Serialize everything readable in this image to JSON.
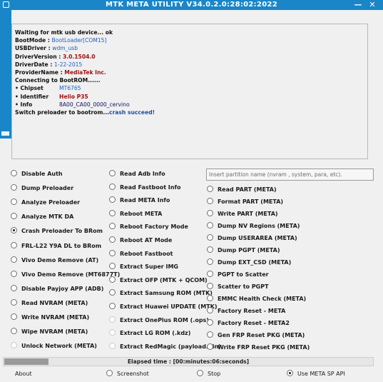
{
  "window": {
    "title": "MTK META UTILITY V34.0.2.0:28:02:2022",
    "minimize_label": "—",
    "close_label": "✕"
  },
  "log": {
    "lines": [
      {
        "text": "Waiting for mtk usb device... ok",
        "value": ""
      },
      {
        "text": "BootMode : ",
        "value": "BootLoader[COM15]",
        "style": "blue"
      },
      {
        "text": "USBDriver : ",
        "value": "wdm_usb",
        "style": "blue"
      },
      {
        "text": "DriverVersion : ",
        "value": "3.0.1504.0",
        "style": "red"
      },
      {
        "text": "DriverDate : ",
        "value": "1-22-2015",
        "style": "blue"
      },
      {
        "text": "ProviderName : ",
        "value": "MediaTek Inc.",
        "style": "red"
      },
      {
        "text": "Connecting to BootROM......",
        "value": ""
      },
      {
        "text": "• Chipset",
        "value": "MT6765",
        "style": "blue"
      },
      {
        "text": "• Identifier",
        "value": "Helio P35",
        "style": "red"
      },
      {
        "text": "• Info",
        "value": "8A00_CA00_0000_cervino",
        "style": "navy"
      },
      {
        "text": "Switch preloader to bootrom...",
        "value": "crash succeed!",
        "style": "green"
      }
    ]
  },
  "col1": [
    {
      "label": "Disable Auth"
    },
    {
      "label": "Dump Preloader"
    },
    {
      "label": "Analyze Preloader"
    },
    {
      "label": "Analyze MTK DA"
    },
    {
      "label": "Crash Preloader To BRom",
      "checked": true
    },
    {
      "label": "FRL-L22 Y9A DL to BRom"
    },
    {
      "label": "Vivo Demo Remove (AT)"
    },
    {
      "label": "Vivo Demo Remove (MT6877T)"
    },
    {
      "label": "Disable Payjoy APP (ADB)"
    },
    {
      "label": "Read NVRAM (META)"
    },
    {
      "label": "Write NVRAM (META)"
    },
    {
      "label": "Wipe NVRAM (META)"
    },
    {
      "label": "Unlock Network (META)",
      "disabled": true
    }
  ],
  "col2": [
    {
      "label": "Read Adb Info"
    },
    {
      "label": "Read Fastboot Info"
    },
    {
      "label": "Read META Info"
    },
    {
      "label": "Reboot META"
    },
    {
      "label": "Reboot Factory Mode"
    },
    {
      "label": "Reboot AT Mode"
    },
    {
      "label": "Reboot Fastboot"
    },
    {
      "label": "Extract Super IMG"
    },
    {
      "label": "Extract OFP (MTK + QCOM)"
    },
    {
      "label": "Extract Samsung ROM (MTK)"
    },
    {
      "label": "Extract Huawei UPDATE (MTK)"
    },
    {
      "label": "Extract OnePlus ROM (.ops)",
      "disabled": true
    },
    {
      "label": "Extract LG ROM (.kdz)",
      "disabled": true
    },
    {
      "label": "Extract RedMagic (payload.bin)",
      "disabled": true
    }
  ],
  "partition": {
    "placeholder": "Insert partition name (nvram , system, para, etc)."
  },
  "col3": [
    {
      "label": "Read PART (META)"
    },
    {
      "label": "Format PART (META)"
    },
    {
      "label": "Write PART (META)"
    },
    {
      "label": "Dump NV Regions (META)"
    },
    {
      "label": "Dump USERAREA (META)"
    },
    {
      "label": "Dump PGPT (META)"
    },
    {
      "label": "Dump  EXT_CSD (META)"
    },
    {
      "label": "PGPT to Scatter"
    },
    {
      "label": "Scatter to PGPT"
    },
    {
      "label": "EMMC Health Check (META)"
    },
    {
      "label": "Factory Reset - META"
    },
    {
      "label": "Factory Reset - META2"
    },
    {
      "label": "Gen FRP Reset PKG (META)"
    },
    {
      "label": "Write FRP Reset PKG (META)"
    }
  ],
  "progress": {
    "elapsed_label": "Elapsed time : [00:minutes:06:seconds]",
    "value_fraction": 0.12
  },
  "bottom": {
    "about_label": "About",
    "screenshot_label": "Screenshot",
    "stop_label": "Stop",
    "meta_sp_label": "Use META SP API",
    "meta_sp_checked": true
  }
}
